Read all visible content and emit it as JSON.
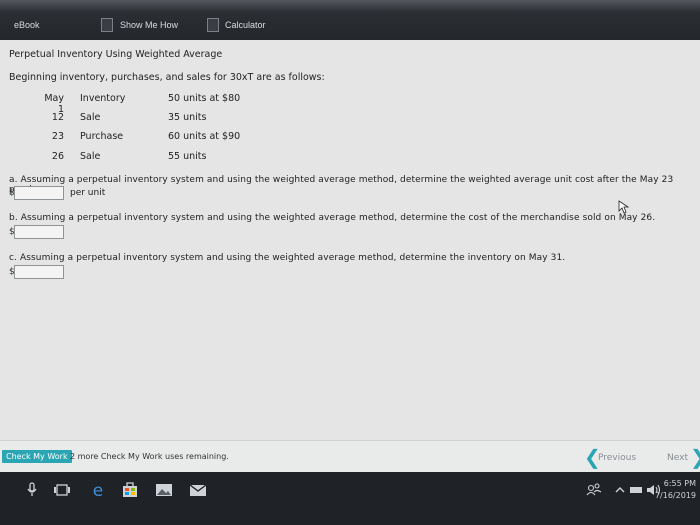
{
  "toolbar": {
    "ebook": "eBook",
    "show_me_how": "Show Me How",
    "calculator": "Calculator"
  },
  "page": {
    "title": "Perpetual Inventory Using Weighted Average",
    "intro": "Beginning inventory, purchases, and sales for 30xT are as follows:"
  },
  "transactions": [
    {
      "date": "May 1",
      "type": "Inventory",
      "detail": "50 units at $80"
    },
    {
      "date": "12",
      "type": "Sale",
      "detail": "35 units"
    },
    {
      "date": "23",
      "type": "Purchase",
      "detail": "60 units at $90"
    },
    {
      "date": "26",
      "type": "Sale",
      "detail": "55 units"
    }
  ],
  "questions": {
    "a": {
      "text": "a. Assuming a perpetual inventory system and using the weighted average method, determine the weighted average unit cost after the May 23 purchase.",
      "prefix": "$",
      "suffix": "per unit",
      "value": ""
    },
    "b": {
      "text": "b. Assuming a perpetual inventory system and using the weighted average method, determine the cost of the merchandise sold on May 26.",
      "prefix": "$",
      "value": ""
    },
    "c": {
      "text": "c. Assuming a perpetual inventory system and using the weighted average method, determine the inventory on May 31.",
      "prefix": "$",
      "value": ""
    }
  },
  "footer": {
    "check_label": "Check My Work",
    "remaining": "2 more Check My Work uses remaining.",
    "previous": "Previous",
    "next": "Next"
  },
  "taskbar": {
    "time": "6:55 PM",
    "date": "7/16/2019"
  },
  "colors": {
    "accent": "#2aa5b3"
  }
}
